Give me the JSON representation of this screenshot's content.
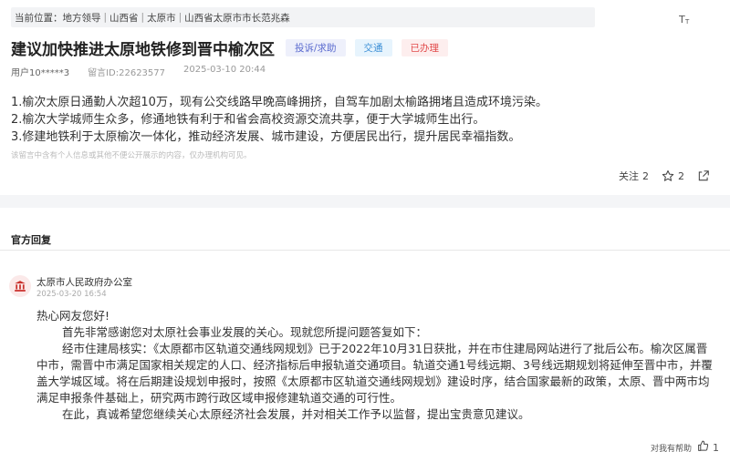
{
  "breadcrumb": {
    "label": "当前位置：",
    "items": [
      "地方领导",
      "山西省",
      "太原市",
      "山西省太原市市长范兆森"
    ]
  },
  "font_size_icon": "font-size-icon",
  "title": "建议加快推进太原地铁修到晋中榆次区",
  "tags": [
    "投诉/求助",
    "交通",
    "已办理"
  ],
  "meta": {
    "user": "用户10*****3",
    "message_id": "留言ID:22623577",
    "time": "2025-03-10 20:44"
  },
  "content": [
    "1.榆次太原日通勤人次超10万，现有公交线路早晚高峰拥挤，自驾车加剧太榆路拥堵且造成环境污染。",
    "2.榆次大学城师生众多，修通地铁有利于和省会高校资源交流共享，便于大学城师生出行。",
    "3.修建地铁利于太原榆次一体化，推动经济发展、城市建设，方便居民出行，提升居民幸福指数。"
  ],
  "note": "该留言中含有个人信息或其他不便公开展示的内容，仅办理机构可见。",
  "actions": {
    "follow_label": "关注",
    "follow_count": "2",
    "star_count": "2"
  },
  "official": {
    "section_title": "官方回复",
    "org_name": "太原市人民政府办公室",
    "date": "2025-03-20 16:54",
    "greeting": "热心网友您好!",
    "paragraphs": [
      "首先非常感谢您对太原社会事业发展的关心。现就您所提问题答复如下：",
      "经市住建局核实：《太原都市区轨道交通线网规划》已于2022年10月31日获批，并在市住建局网站进行了批后公布。榆次区属晋中市，需晋中市满足国家相关规定的人口、经济指标后申报轨道交通项目。轨道交通1号线远期、3号线远期规划将延伸至晋中市，并覆盖大学城区域。将在后期建设规划申报时，按照《太原都市区轨道交通线网规划》建设时序，结合国家最新的政策，太原、晋中两市均满足申报条件基础上，研究两市跨行政区域申报修建轨道交通的可行性。",
      "在此，真诚希望您继续关心太原经济社会发展，并对相关工作予以监督，提出宝贵意见建议。"
    ]
  },
  "helpful": {
    "label": "对我有帮助",
    "count": "1"
  },
  "colors": {
    "tag_red": "#e24c4c",
    "tag_blue": "#3c8fd6",
    "tag_purple": "#5b6bcf",
    "org_red": "#c9302c"
  }
}
